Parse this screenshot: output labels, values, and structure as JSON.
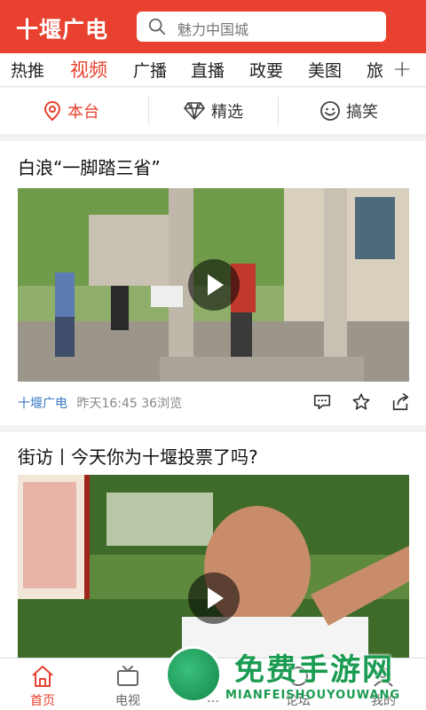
{
  "header": {
    "logo": "十堰广电",
    "search_placeholder": "魅力中国城"
  },
  "tabs": [
    "热推",
    "视频",
    "广播",
    "直播",
    "政要",
    "美图",
    "旅"
  ],
  "active_tab": "视频",
  "subtabs": [
    "本台",
    "精选",
    "搞笑"
  ],
  "active_subtab": "本台",
  "feed": [
    {
      "title": "白浪“一脚踏三省”",
      "source": "十堰广电",
      "time": "昨天16:45",
      "views": "36浏览"
    },
    {
      "title": "街访丨今天你为十堰投票了吗?"
    }
  ],
  "bottom_nav": [
    "首页",
    "电视",
    "…",
    "论坛",
    "我的"
  ],
  "active_nav": "首页",
  "watermark": {
    "title": "免费手游网",
    "sub": "MIANFEISHOUYOUWANG"
  },
  "colors": {
    "brand": "#e8412f",
    "source_link": "#3a78c3"
  }
}
